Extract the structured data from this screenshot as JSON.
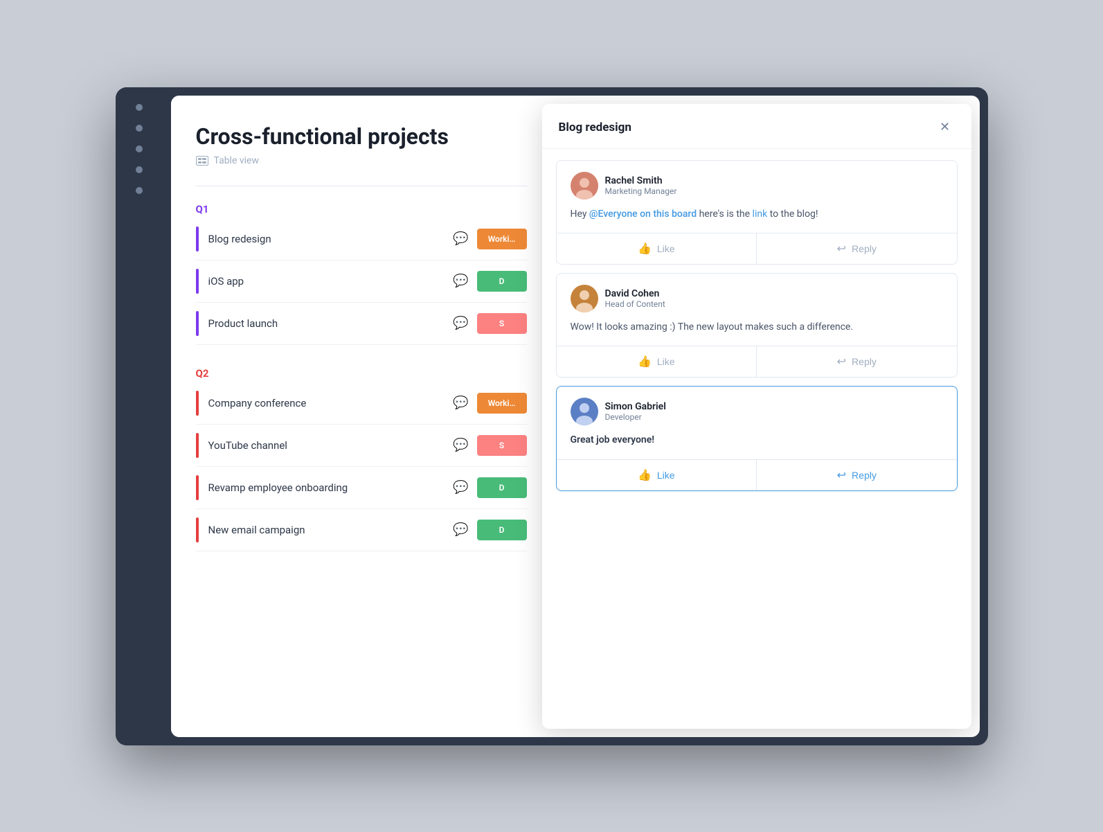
{
  "app": {
    "title": "Cross-functional projects"
  },
  "project_panel": {
    "title": "Cross-functional projects",
    "table_view_label": "Table view",
    "quarters": [
      {
        "id": "q1",
        "label": "Q1",
        "color": "purple",
        "items": [
          {
            "name": "Blog redesign",
            "status": "Working",
            "status_color": "orange",
            "has_chat": true
          },
          {
            "name": "iOS app",
            "status": "D",
            "status_color": "green",
            "has_chat": true
          },
          {
            "name": "Product launch",
            "status": "S",
            "status_color": "red",
            "has_chat": false
          }
        ]
      },
      {
        "id": "q2",
        "label": "Q2",
        "color": "red",
        "items": [
          {
            "name": "Company conference",
            "status": "Working",
            "status_color": "orange",
            "has_chat": false
          },
          {
            "name": "YouTube channel",
            "status": "S",
            "status_color": "red",
            "has_chat": false
          },
          {
            "name": "Revamp employee onboarding",
            "status": "D",
            "status_color": "green",
            "has_chat": false
          },
          {
            "name": "New email campaign",
            "status": "D",
            "status_color": "green",
            "has_chat": false
          }
        ]
      }
    ]
  },
  "comment_panel": {
    "title": "Blog redesign",
    "comments": [
      {
        "id": 1,
        "author_name": "Rachel Smith",
        "author_role": "Marketing Manager",
        "text_parts": [
          {
            "type": "text",
            "value": "Hey "
          },
          {
            "type": "mention",
            "value": "@Everyone on this board"
          },
          {
            "type": "text",
            "value": " here's is the "
          },
          {
            "type": "link",
            "value": "link"
          },
          {
            "type": "text",
            "value": " to the blog!"
          }
        ],
        "like_label": "Like",
        "reply_label": "Reply",
        "active": false
      },
      {
        "id": 2,
        "author_name": "David Cohen",
        "author_role": "Head of Content",
        "text": "Wow! It looks amazing :) The new layout makes such a difference.",
        "like_label": "Like",
        "reply_label": "Reply",
        "active": false
      },
      {
        "id": 3,
        "author_name": "Simon Gabriel",
        "author_role": "Developer",
        "text": "Great job everyone!",
        "like_label": "Like",
        "reply_label": "Reply",
        "active": true
      }
    ]
  }
}
